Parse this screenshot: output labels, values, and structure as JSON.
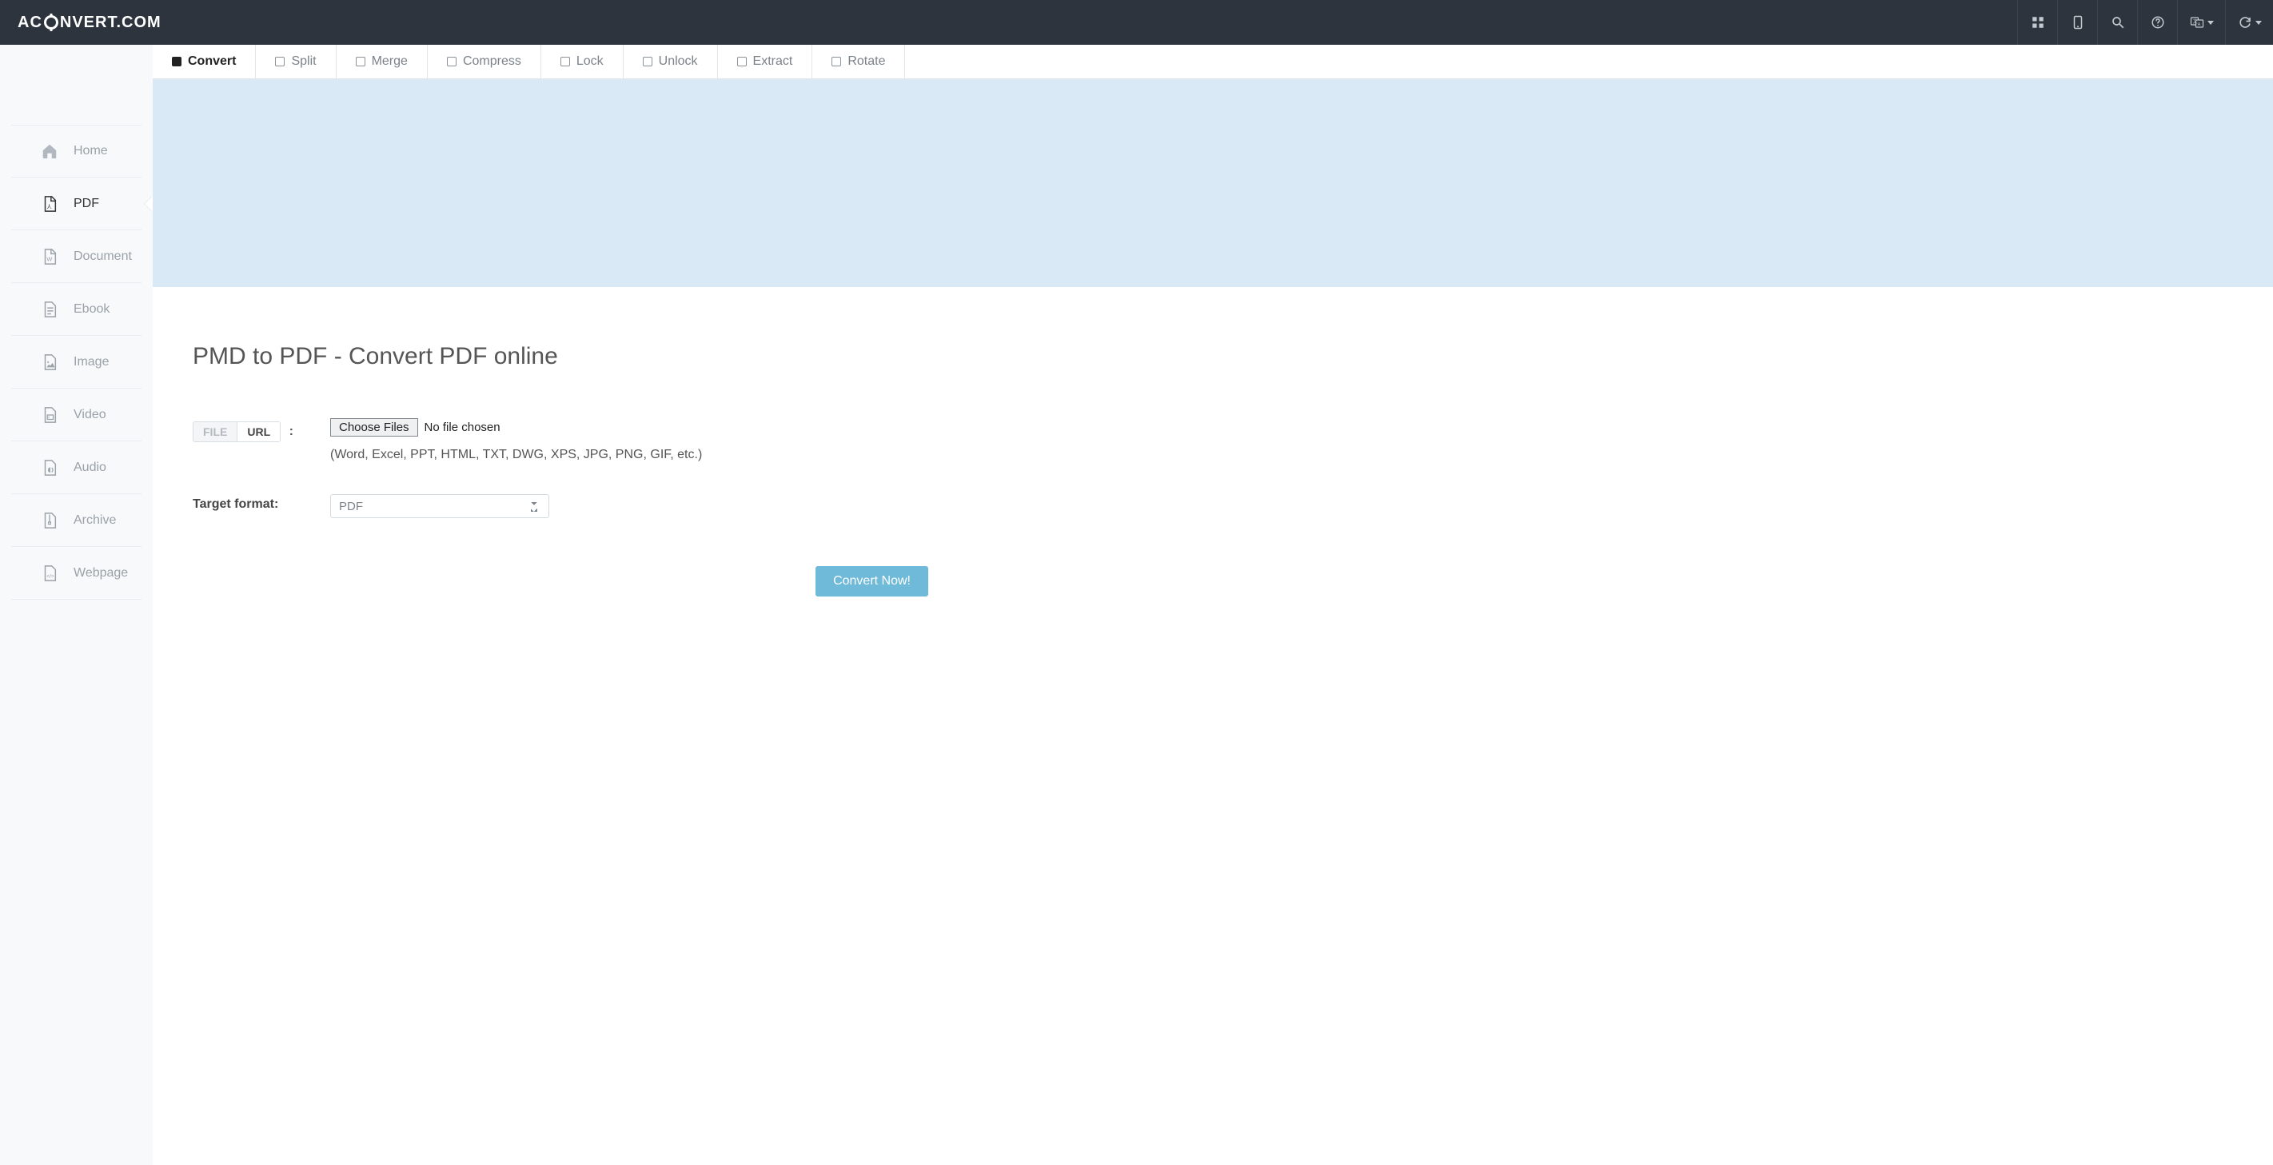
{
  "logo_prefix": "AC",
  "logo_suffix": "NVERT.COM",
  "topbar_icons": [
    {
      "name": "grid-icon"
    },
    {
      "name": "mobile-icon"
    },
    {
      "name": "search-icon"
    },
    {
      "name": "help-icon"
    },
    {
      "name": "language-icon",
      "dropdown": true
    },
    {
      "name": "refresh-icon",
      "dropdown": true
    }
  ],
  "sidebar": {
    "items": [
      {
        "name": "home",
        "label": "Home",
        "icon": "home",
        "active": false
      },
      {
        "name": "pdf",
        "label": "PDF",
        "icon": "pdf",
        "active": true
      },
      {
        "name": "document",
        "label": "Document",
        "icon": "doc",
        "active": false
      },
      {
        "name": "ebook",
        "label": "Ebook",
        "icon": "ebook",
        "active": false
      },
      {
        "name": "image",
        "label": "Image",
        "icon": "image",
        "active": false
      },
      {
        "name": "video",
        "label": "Video",
        "icon": "video",
        "active": false
      },
      {
        "name": "audio",
        "label": "Audio",
        "icon": "audio",
        "active": false
      },
      {
        "name": "archive",
        "label": "Archive",
        "icon": "archive",
        "active": false
      },
      {
        "name": "webpage",
        "label": "Webpage",
        "icon": "webpage",
        "active": false
      }
    ]
  },
  "tabs": [
    {
      "name": "convert",
      "label": "Convert",
      "active": true
    },
    {
      "name": "split",
      "label": "Split"
    },
    {
      "name": "merge",
      "label": "Merge"
    },
    {
      "name": "compress",
      "label": "Compress"
    },
    {
      "name": "lock",
      "label": "Lock"
    },
    {
      "name": "unlock",
      "label": "Unlock"
    },
    {
      "name": "extract",
      "label": "Extract"
    },
    {
      "name": "rotate",
      "label": "Rotate"
    }
  ],
  "page_title": "PMD to PDF - Convert PDF online",
  "form": {
    "source_file_seg": "FILE",
    "source_url_seg": "URL",
    "source_colon": ":",
    "choose_files_label": "Choose Files",
    "no_file_text": "No file chosen",
    "hint_text": "(Word, Excel, PPT, HTML, TXT, DWG, XPS, JPG, PNG, GIF, etc.)",
    "target_label": "Target format:",
    "target_selected": "PDF",
    "target_options": [
      "PDF"
    ],
    "submit_label": "Convert Now!"
  }
}
